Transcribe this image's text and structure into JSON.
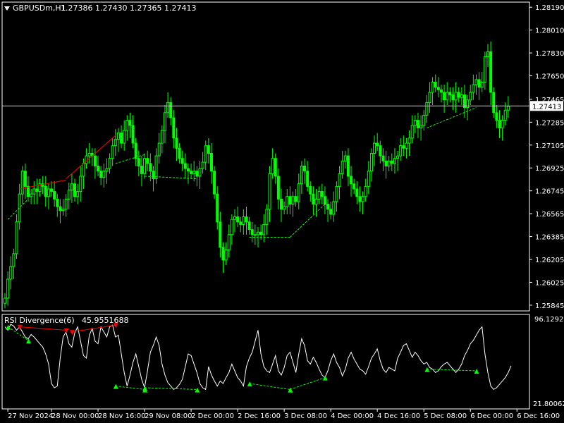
{
  "header": {
    "symbol": "GBPUSDm,H1",
    "ohlc": "1.27386 1.27430 1.27365 1.27413"
  },
  "indicator": {
    "name": "RSI Divergence(6)",
    "value": "45.9551688",
    "scale_max": "96.12928",
    "scale_min": "21.800624"
  },
  "colors": {
    "background": "#000000",
    "frame": "#ffffff",
    "candle": "#00ff00",
    "rsi_line": "#ffffff",
    "divergence_bearish": "#ff0000",
    "divergence_bullish": "#00ff00",
    "current_price_label": "#ffffff"
  },
  "icons": {
    "symbol_menu": "caret-down-icon"
  },
  "chart_data": {
    "type": "candlestick",
    "price_axis": {
      "ticks": [
        "1.28190",
        "1.28010",
        "1.27830",
        "1.27650",
        "1.27465",
        "1.27285",
        "1.27105",
        "1.26925",
        "1.26745",
        "1.26565",
        "1.26385",
        "1.26205",
        "1.26025",
        "1.25845"
      ],
      "tick_values": [
        1.2819,
        1.2801,
        1.2783,
        1.2765,
        1.27465,
        1.27285,
        1.27105,
        1.26925,
        1.26745,
        1.26565,
        1.26385,
        1.26205,
        1.26025,
        1.25845
      ],
      "range": [
        1.258,
        1.2823
      ]
    },
    "current_price": {
      "value": 1.27413,
      "label": "1.27413"
    },
    "time_axis": {
      "labels": [
        "27 Nov 2024",
        "28 Nov 00:00",
        "28 Nov 16:00",
        "29 Nov 08:00",
        "2 Dec 00:00",
        "2 Dec 16:00",
        "3 Dec 08:00",
        "4 Dec 00:00",
        "4 Dec 16:00",
        "5 Dec 08:00",
        "6 Dec 00:00",
        "6 Dec 16:00"
      ],
      "label_positions": [
        1,
        16,
        32,
        48,
        64,
        80,
        96,
        112,
        128,
        144,
        160,
        176
      ]
    },
    "price_series": [
      1.259,
      1.2605,
      1.2615,
      1.2625,
      1.265,
      1.2672,
      1.269,
      1.2678,
      1.267,
      1.2672,
      1.2676,
      1.2674,
      1.268,
      1.2678,
      1.267,
      1.2676,
      1.2674,
      1.2668,
      1.2662,
      1.2659,
      1.266,
      1.2668,
      1.2675,
      1.268,
      1.267,
      1.2674,
      1.2686,
      1.2696,
      1.2702,
      1.2704,
      1.2702,
      1.2694,
      1.269,
      1.2685,
      1.269,
      1.2692,
      1.27,
      1.271,
      1.2715,
      1.272,
      1.2712,
      1.2722,
      1.273,
      1.2726,
      1.2712,
      1.27,
      1.2694,
      1.2688,
      1.27,
      1.2696,
      1.269,
      1.2684,
      1.2702,
      1.2712,
      1.2722,
      1.2736,
      1.2744,
      1.2732,
      1.2716,
      1.2708,
      1.27,
      1.2696,
      1.2692,
      1.269,
      1.2688,
      1.269,
      1.2686,
      1.2692,
      1.2697,
      1.271,
      1.2704,
      1.269,
      1.2672,
      1.265,
      1.263,
      1.262,
      1.2628,
      1.264,
      1.2652,
      1.2654,
      1.265,
      1.2648,
      1.2654,
      1.265,
      1.2644,
      1.264,
      1.264,
      1.2642,
      1.264,
      1.2648,
      1.266,
      1.2688,
      1.27,
      1.2686,
      1.2668,
      1.266,
      1.2662,
      1.267,
      1.2664,
      1.267,
      1.2666,
      1.268,
      1.2694,
      1.269,
      1.2678,
      1.2672,
      1.2664,
      1.2668,
      1.2674,
      1.267,
      1.2664,
      1.266,
      1.2656,
      1.2666,
      1.2678,
      1.2688,
      1.2698,
      1.2702,
      1.2686,
      1.268,
      1.2676,
      1.267,
      1.2666,
      1.267,
      1.2678,
      1.269,
      1.2704,
      1.2712,
      1.271,
      1.2702,
      1.2698,
      1.2694,
      1.2698,
      1.2696,
      1.27,
      1.2702,
      1.271,
      1.2708,
      1.2712,
      1.2716,
      1.2726,
      1.273,
      1.2724,
      1.2726,
      1.2734,
      1.2744,
      1.2752,
      1.276,
      1.2756,
      1.2754,
      1.2752,
      1.2746,
      1.2752,
      1.275,
      1.2746,
      1.2752,
      1.2748,
      1.275,
      1.274,
      1.2746,
      1.2752,
      1.2758,
      1.2762,
      1.2756,
      1.276,
      1.278,
      1.2784,
      1.2752,
      1.2736,
      1.273,
      1.2724,
      1.273,
      1.2738,
      1.2741
    ],
    "rsi_series": [
      92,
      88,
      95,
      93,
      88,
      92,
      86,
      80,
      78,
      83,
      80,
      76,
      72,
      68,
      60,
      48,
      25,
      20,
      22,
      55,
      80,
      86,
      72,
      68,
      85,
      92,
      75,
      58,
      55,
      82,
      90,
      75,
      72,
      92,
      86,
      80,
      92,
      94,
      80,
      82,
      60,
      38,
      22,
      35,
      50,
      60,
      45,
      30,
      20,
      40,
      62,
      70,
      80,
      70,
      48,
      35,
      26,
      22,
      18,
      20,
      24,
      30,
      45,
      60,
      58,
      48,
      38,
      25,
      20,
      18,
      45,
      35,
      28,
      22,
      28,
      25,
      32,
      38,
      48,
      40,
      32,
      28,
      22,
      45,
      55,
      62,
      75,
      88,
      60,
      45,
      40,
      38,
      48,
      58,
      40,
      35,
      44,
      58,
      62,
      50,
      38,
      60,
      78,
      70,
      52,
      48,
      56,
      50,
      42,
      35,
      32,
      40,
      52,
      60,
      50,
      44,
      34,
      42,
      55,
      62,
      54,
      48,
      42,
      40,
      36,
      45,
      55,
      60,
      66,
      52,
      42,
      38,
      44,
      42,
      40,
      55,
      62,
      70,
      72,
      64,
      56,
      62,
      58,
      52,
      48,
      50,
      44,
      42,
      38,
      40,
      45,
      48,
      50,
      46,
      42,
      38,
      42,
      48,
      58,
      64,
      72,
      76,
      82,
      88,
      92,
      60,
      38,
      22,
      18,
      20,
      24,
      28,
      32,
      38,
      46
    ],
    "divergence_lines": [
      {
        "type": "bearish",
        "price": [
          [
            5,
            1.2676
          ],
          [
            21,
            1.2683
          ]
        ],
        "rsi": [
          [
            5,
            92
          ],
          [
            21,
            88
          ]
        ]
      },
      {
        "type": "bearish",
        "price": [
          [
            21,
            1.2684
          ],
          [
            38,
            1.2718
          ]
        ],
        "rsi": [
          [
            23,
            86
          ],
          [
            38,
            94
          ]
        ]
      },
      {
        "type": "bullish",
        "price": [
          [
            38,
            1.2696
          ],
          [
            48,
            1.2703
          ]
        ],
        "rsi": [
          [
            38,
            22
          ],
          [
            48,
            18
          ]
        ]
      },
      {
        "type": "bullish",
        "price": [
          [
            48,
            1.2686
          ],
          [
            66,
            1.2684
          ]
        ],
        "rsi": [
          [
            48,
            20
          ],
          [
            66,
            18
          ]
        ]
      },
      {
        "type": "bullish",
        "price": [
          [
            84,
            1.2638
          ],
          [
            98,
            1.2638
          ]
        ],
        "rsi": [
          [
            84,
            25
          ],
          [
            98,
            18
          ]
        ]
      },
      {
        "type": "bullish",
        "price": [
          [
            98,
            1.2638
          ],
          [
            110,
            1.2664
          ]
        ],
        "rsi": [
          [
            98,
            18
          ],
          [
            110,
            32
          ]
        ]
      },
      {
        "type": "bullish",
        "price": [
          [
            145,
            1.2724
          ],
          [
            162,
            1.274
          ]
        ],
        "rsi": [
          [
            145,
            42
          ],
          [
            162,
            40
          ]
        ]
      },
      {
        "type": "bullish",
        "price": [
          [
            1,
            1.2652
          ],
          [
            8,
            1.2668
          ]
        ],
        "rsi": [
          [
            1,
            92
          ],
          [
            8,
            76
          ]
        ]
      }
    ],
    "rsi_range": [
      0,
      100
    ]
  }
}
